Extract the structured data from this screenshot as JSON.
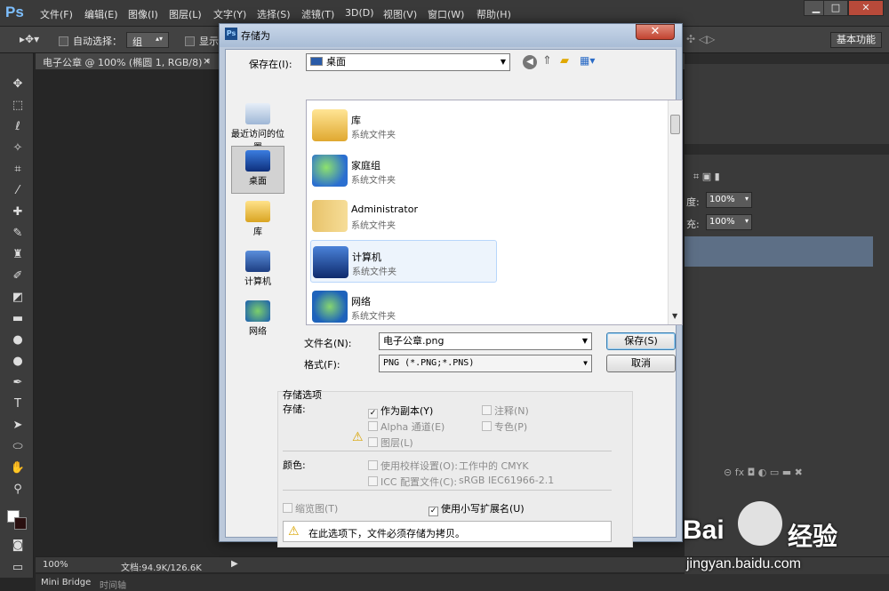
{
  "app": {
    "logo": "Ps",
    "menus": [
      "文件(F)",
      "编辑(E)",
      "图像(I)",
      "图层(L)",
      "文字(Y)",
      "选择(S)",
      "滤镜(T)",
      "3D(D)",
      "视图(V)",
      "窗口(W)",
      "帮助(H)"
    ],
    "window_buttons": [
      "▁",
      "□",
      "✕"
    ]
  },
  "options": {
    "auto_select": "自动选择：",
    "group": "组",
    "show": "显示",
    "workspace": "基本功能"
  },
  "doc_tab": {
    "title": "电子公章 @ 100% (椭圆 1, RGB/8) *",
    "close": "×"
  },
  "right_panel": {
    "opacity_label": "度:",
    "opacity_value": "100%",
    "fill_label": "充:",
    "fill_value": "100%"
  },
  "status": {
    "zoom": "100%",
    "doc_size": "文档:94.9K/126.6K"
  },
  "bottom_tabs": [
    "Mini Bridge",
    "时间轴"
  ],
  "dialog": {
    "title": "存储为",
    "close": "✕",
    "save_in_label": "保存在(I):",
    "save_in_value": "桌面",
    "places": [
      {
        "label": "最近访问的位置",
        "icon": "recent-places-icon"
      },
      {
        "label": "桌面",
        "icon": "desktop-icon"
      },
      {
        "label": "库",
        "icon": "library-icon"
      },
      {
        "label": "计算机",
        "icon": "computer-icon"
      },
      {
        "label": "网络",
        "icon": "network-icon"
      }
    ],
    "files": [
      {
        "name": "库",
        "type": "系统文件夹",
        "icon": "library-folder-icon"
      },
      {
        "name": "家庭组",
        "type": "系统文件夹",
        "icon": "homegroup-icon"
      },
      {
        "name": "Administrator",
        "type": "系统文件夹",
        "icon": "user-folder-icon"
      },
      {
        "name": "计算机",
        "type": "系统文件夹",
        "icon": "computer-icon"
      },
      {
        "name": "网络",
        "type": "系统文件夹",
        "icon": "network-icon"
      }
    ],
    "filename_label": "文件名(N):",
    "filename_value": "电子公章.png",
    "format_label": "格式(F):",
    "format_value": "PNG (*.PNG;*.PNS)",
    "save_button": "保存(S)",
    "cancel_button": "取消",
    "options_title": "存储选项",
    "storage_label": "存储:",
    "as_copy": "作为副本(Y)",
    "annotations": "注释(N)",
    "alpha": "Alpha 通道(E)",
    "spot": "专色(P)",
    "layers": "图层(L)",
    "color_label": "颜色:",
    "proof": "使用校样设置(O):",
    "proof_value": "工作中的 CMYK",
    "icc": "ICC 配置文件(C):",
    "icc_value": "sRGB IEC61966-2.1",
    "thumbnail": "缩览图(T)",
    "lowercase_ext": "使用小写扩展名(U)",
    "warning": "在此选项下，文件必须存储为拷贝。"
  },
  "watermark": {
    "brand": "Bai",
    "brand2": "经验",
    "url": "jingyan.baidu.com"
  }
}
